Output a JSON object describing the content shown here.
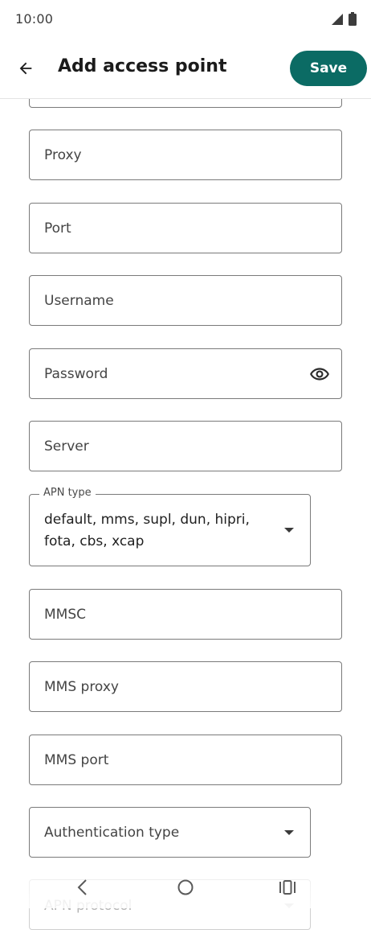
{
  "status_bar": {
    "time": "10:00"
  },
  "app_bar": {
    "title": "Add access point",
    "save_label": "Save"
  },
  "fields": {
    "proxy": "Proxy",
    "port": "Port",
    "username": "Username",
    "password": "Password",
    "server": "Server",
    "apn_type_label": "APN type",
    "apn_type_value_line1": "default, mms, supl, dun, hipri,",
    "apn_type_value_line2": "fota, cbs, xcap",
    "mmsc": "MMSC",
    "mms_proxy": "MMS proxy",
    "mms_port": "MMS port",
    "authentication_type": "Authentication type",
    "apn_protocol": "APN protocol"
  },
  "icons": {
    "back": "arrow-back-icon",
    "eye": "visibility-icon",
    "signal": "cellular-signal-icon",
    "battery": "battery-icon"
  },
  "colors": {
    "accent": "#0b6b64",
    "border": "#7a7a7a"
  }
}
